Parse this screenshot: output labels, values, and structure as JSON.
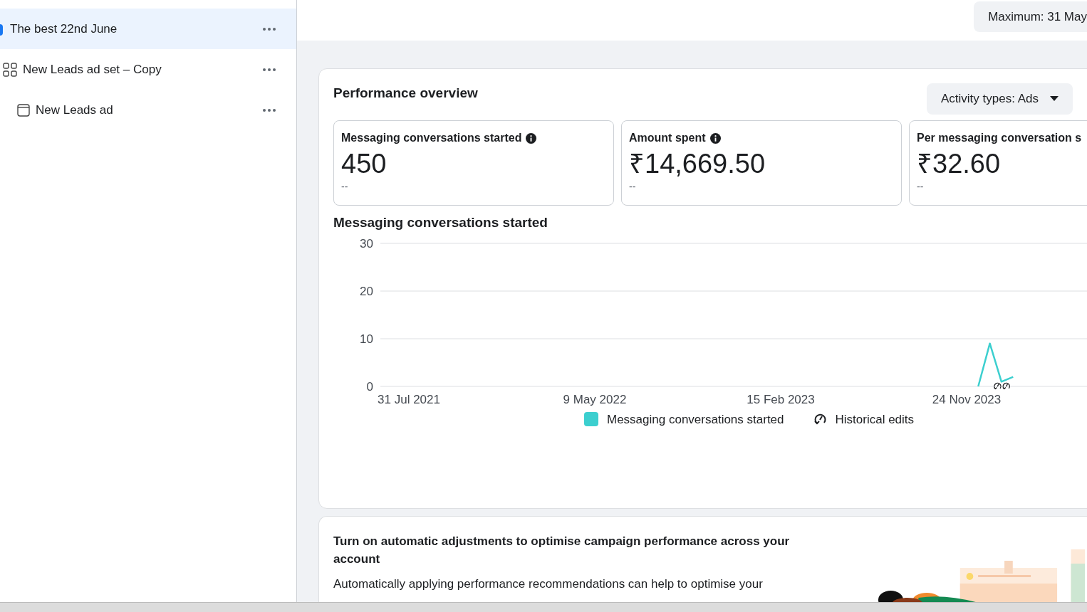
{
  "sidebar": {
    "items": [
      {
        "kind": "campaign",
        "label": "The best 22nd June",
        "selected": true
      },
      {
        "kind": "adset",
        "label": "New Leads ad set – Copy",
        "selected": false,
        "children": [
          {
            "kind": "ad",
            "label": "New Leads ad",
            "selected": false
          }
        ]
      }
    ]
  },
  "header": {
    "date_button": "Maximum: 31 May"
  },
  "performance": {
    "title": "Performance overview",
    "filter_button": "Activity types: Ads",
    "metrics": [
      {
        "label": "Messaging conversations started",
        "info": true,
        "value": "450",
        "change": "--"
      },
      {
        "label": "Amount spent",
        "info": true,
        "value": "₹14,669.50",
        "change": "--"
      },
      {
        "label": "Per messaging conversation s",
        "info": false,
        "value": "₹32.60",
        "change": "--"
      }
    ],
    "chart_title": "Messaging conversations started",
    "chart_data": {
      "type": "line",
      "ylim": [
        0,
        30
      ],
      "yticks": [
        0,
        10,
        20,
        30
      ],
      "categories": [
        null,
        null,
        "31 Jul 2021",
        null,
        null,
        null,
        null,
        null,
        null,
        null,
        null,
        null,
        null,
        null,
        null,
        null,
        null,
        null,
        "9 May 2022",
        null,
        null,
        null,
        null,
        null,
        null,
        null,
        null,
        null,
        null,
        null,
        null,
        null,
        null,
        null,
        "15 Feb 2023",
        null,
        null,
        null,
        null,
        null,
        null,
        null,
        null,
        null,
        null,
        null,
        null,
        null,
        null,
        null,
        "24 Nov 2023",
        null,
        null,
        null,
        null
      ],
      "series": [
        {
          "name": "Messaging conversations started",
          "color": "#3ccfcf",
          "values": [
            null,
            null,
            null,
            null,
            null,
            null,
            null,
            null,
            null,
            null,
            null,
            null,
            null,
            null,
            null,
            null,
            null,
            null,
            null,
            null,
            null,
            null,
            null,
            null,
            null,
            null,
            null,
            null,
            null,
            null,
            null,
            null,
            null,
            null,
            null,
            null,
            null,
            null,
            null,
            null,
            null,
            null,
            null,
            null,
            null,
            null,
            null,
            null,
            null,
            null,
            null,
            0,
            9,
            1,
            2
          ]
        }
      ]
    },
    "legend": [
      {
        "kind": "edits",
        "label": "Historical edits"
      }
    ]
  },
  "recommendation": {
    "title": "Turn on automatic adjustments to optimise campaign performance across your account",
    "body": "Automatically applying performance recommendations can help to optimise your"
  }
}
